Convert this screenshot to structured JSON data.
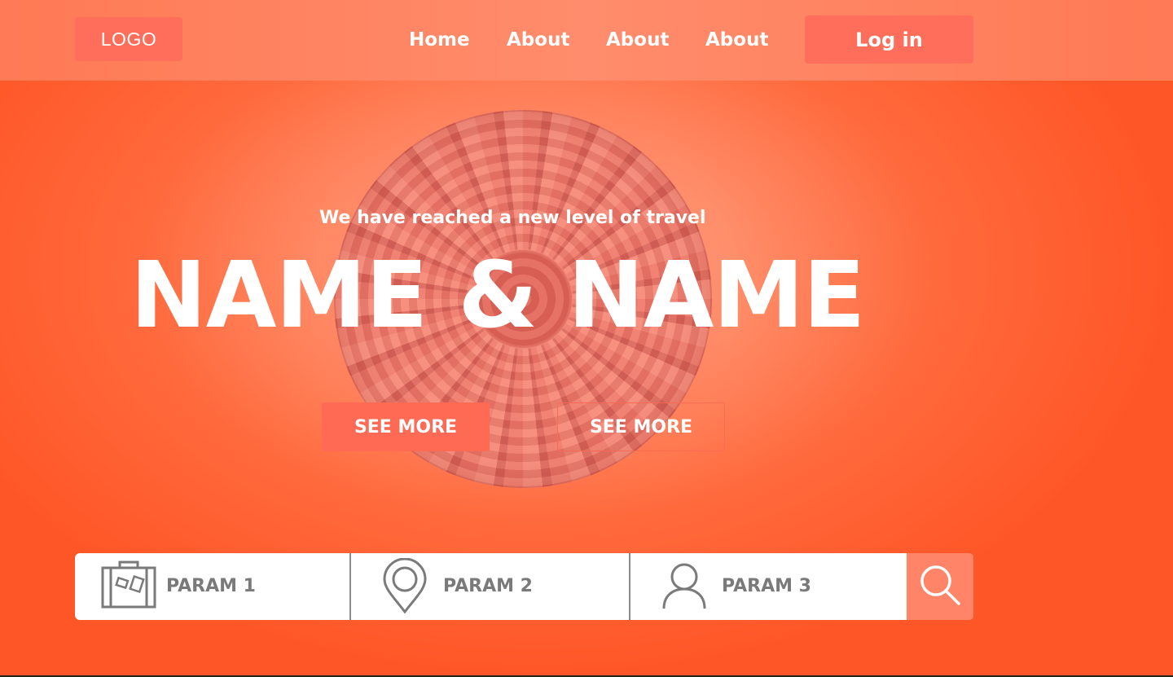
{
  "header": {
    "logo": "LOGO",
    "nav": [
      "Home",
      "About",
      "About",
      "About"
    ],
    "login": "Log in"
  },
  "hero": {
    "tagline": "We have reached a new level of travel",
    "headline": "NAME & NAME",
    "primary_button": "SEE MORE",
    "secondary_button": "SEE MORE"
  },
  "search": {
    "params": [
      {
        "label": "PARAM 1",
        "icon": "luggage-icon"
      },
      {
        "label": "PARAM 2",
        "icon": "location-pin-icon"
      },
      {
        "label": "PARAM 3",
        "icon": "user-icon"
      }
    ],
    "button_icon": "search-icon"
  },
  "colors": {
    "accent": "#ff6a55",
    "background": "#ff5627",
    "header": "#ff8c6c",
    "search_button": "#ff8468"
  }
}
